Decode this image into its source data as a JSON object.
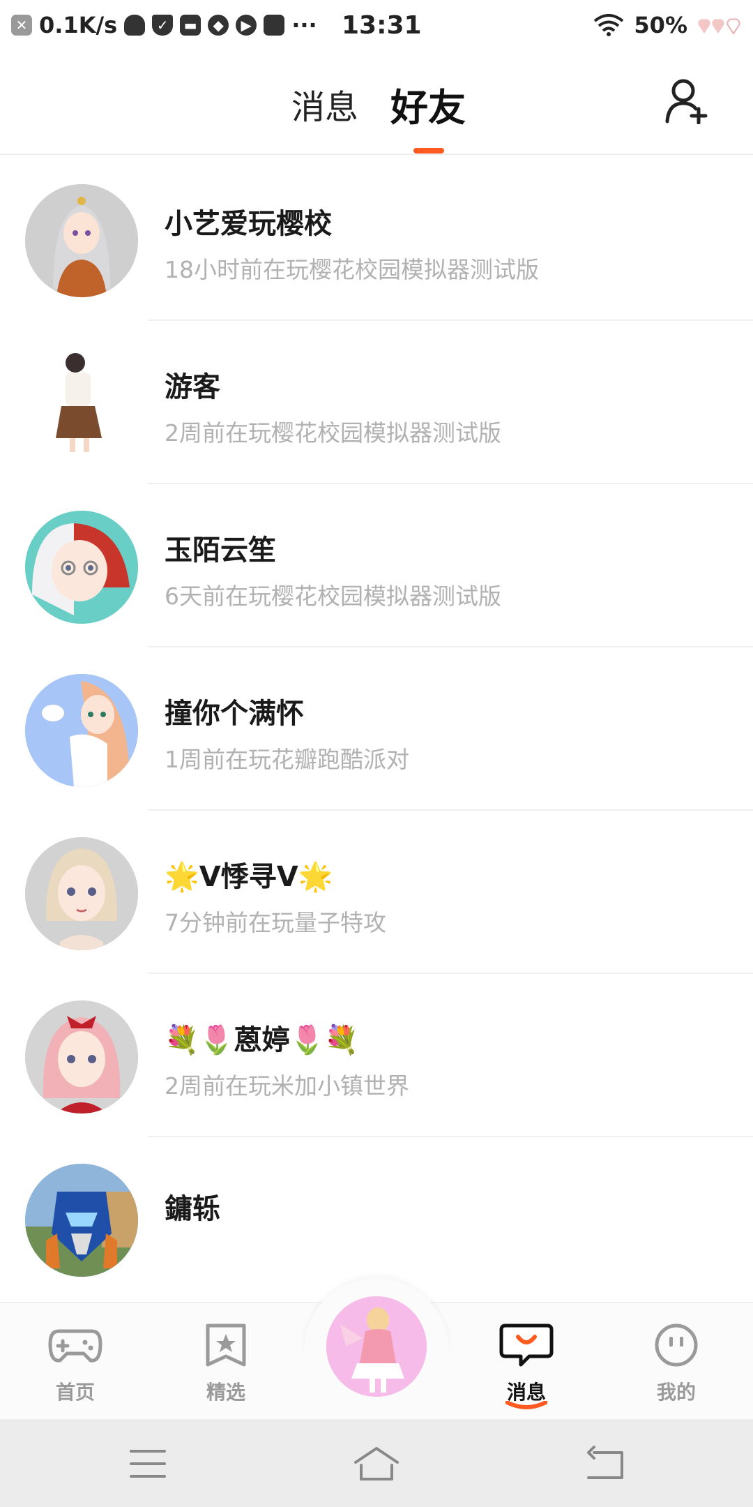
{
  "status_bar": {
    "net_speed": "0.1K/s",
    "time": "13:31",
    "battery": "50%",
    "more": "···"
  },
  "header": {
    "tab_messages": "消息",
    "tab_friends": "好友",
    "active_tab": "好友",
    "accent_color": "#ff5a1f"
  },
  "friends": [
    {
      "name": "小艺爱玩樱校",
      "status": "18小时前在玩樱花校园模拟器测试版"
    },
    {
      "name": "游客",
      "status": "2周前在玩樱花校园模拟器测试版"
    },
    {
      "name": "玉陌云笙",
      "status": "6天前在玩樱花校园模拟器测试版"
    },
    {
      "name": "撞你个满怀",
      "status": "1周前在玩花瓣跑酷派对"
    },
    {
      "name": "🌟V悸寻V🌟",
      "status": "7分钟前在玩量子特攻"
    },
    {
      "name": "💐🌷蒽婷🌷💐",
      "status": "2周前在玩米加小镇世界"
    },
    {
      "name": "鏞轹",
      "status": ""
    }
  ],
  "bottom_nav": {
    "home": "首页",
    "featured": "精选",
    "messages": "消息",
    "me": "我的",
    "active": "消息"
  }
}
